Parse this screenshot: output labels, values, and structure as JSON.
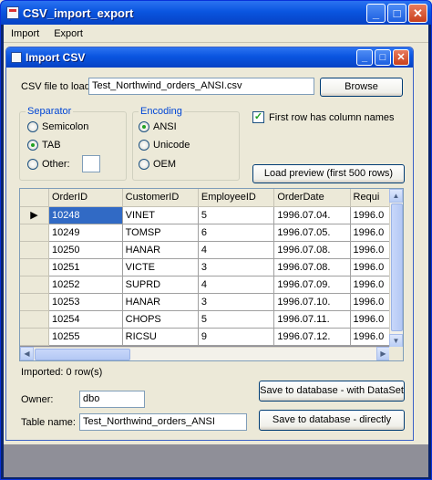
{
  "app": {
    "title": "CSV_import_export",
    "menu": [
      "Import",
      "Export"
    ]
  },
  "dialog": {
    "title": "Import CSV",
    "csv_file_label": "CSV file to load:",
    "csv_file_value": "Test_Northwind_orders_ANSI.csv",
    "browse_label": "Browse",
    "separator": {
      "title": "Separator",
      "options": [
        "Semicolon",
        "TAB",
        "Other:"
      ],
      "selected": "TAB",
      "other_value": ""
    },
    "encoding": {
      "title": "Encoding",
      "options": [
        "ANSI",
        "Unicode",
        "OEM"
      ],
      "selected": "ANSI"
    },
    "first_row_label": "First row has column names",
    "first_row_checked": true,
    "load_preview_label": "Load preview (first 500 rows)",
    "grid": {
      "columns": [
        "OrderID",
        "CustomerID",
        "EmployeeID",
        "OrderDate",
        "Requi"
      ],
      "rows": [
        [
          "10248",
          "VINET",
          "5",
          "1996.07.04.",
          "1996.0"
        ],
        [
          "10249",
          "TOMSP",
          "6",
          "1996.07.05.",
          "1996.0"
        ],
        [
          "10250",
          "HANAR",
          "4",
          "1996.07.08.",
          "1996.0"
        ],
        [
          "10251",
          "VICTE",
          "3",
          "1996.07.08.",
          "1996.0"
        ],
        [
          "10252",
          "SUPRD",
          "4",
          "1996.07.09.",
          "1996.0"
        ],
        [
          "10253",
          "HANAR",
          "3",
          "1996.07.10.",
          "1996.0"
        ],
        [
          "10254",
          "CHOPS",
          "5",
          "1996.07.11.",
          "1996.0"
        ],
        [
          "10255",
          "RICSU",
          "9",
          "1996.07.12.",
          "1996.0"
        ]
      ]
    },
    "imported_label": "Imported: 0 row(s)",
    "owner_label": "Owner:",
    "owner_value": "dbo",
    "table_name_label": "Table name:",
    "table_name_value": "Test_Northwind_orders_ANSI",
    "save_dataset_label": "Save to database - with DataSet",
    "save_direct_label": "Save to database - directly"
  }
}
